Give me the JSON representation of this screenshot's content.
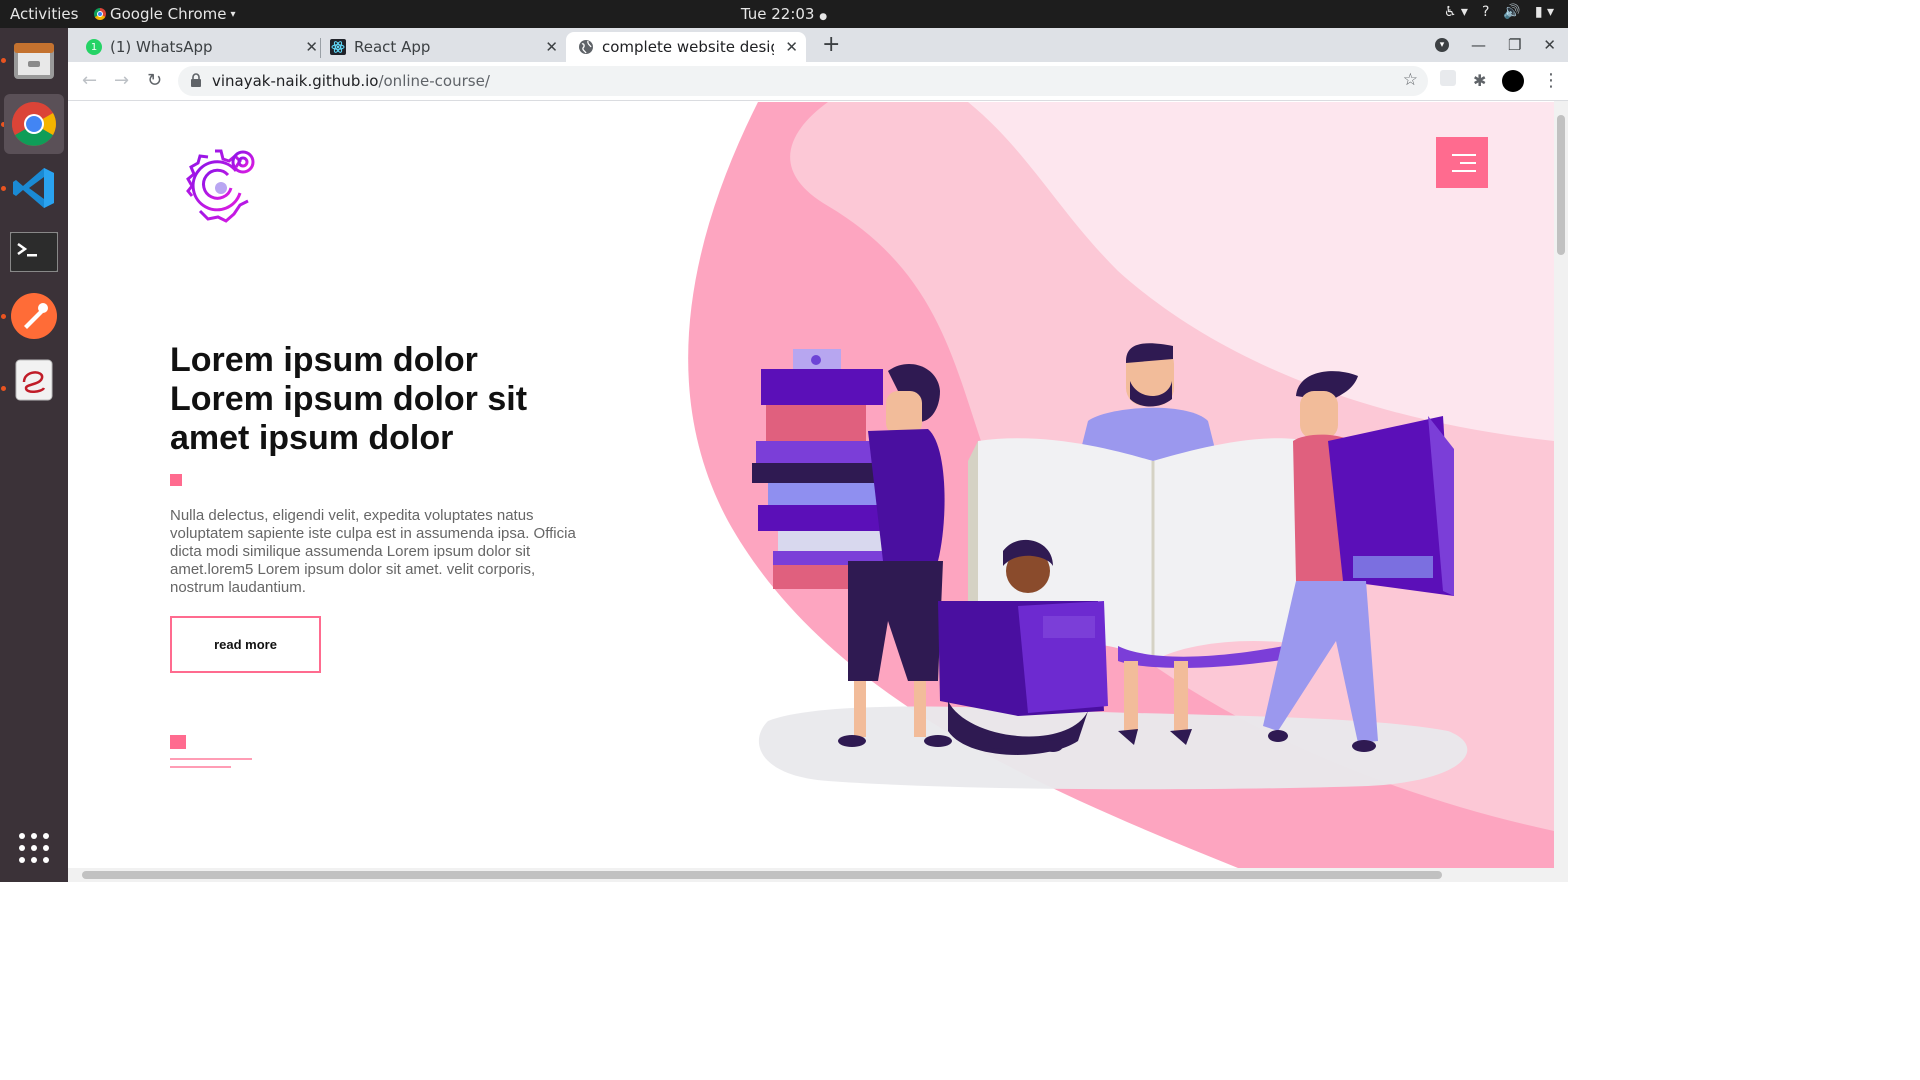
{
  "system": {
    "activities": "Activities",
    "app_name": "Google Chrome",
    "clock": "Tue 22:03"
  },
  "browser": {
    "tabs": [
      {
        "title": "(1) WhatsApp",
        "icon": "whatsapp-icon",
        "badge": "1"
      },
      {
        "title": "React App",
        "icon": "react-icon"
      },
      {
        "title": "complete website design",
        "icon": "globe-icon",
        "active": true
      }
    ],
    "url_host": "vinayak-naik.github.io",
    "url_path": "/online-course/"
  },
  "hero": {
    "title_lines": [
      "Lorem ipsum dolor",
      "Lorem ipsum dolor sit",
      "amet ipsum dolor"
    ],
    "paragraph": "Nulla delectus, eligendi velit, expedita voluptates natus voluptatem sapiente iste culpa est in assumenda ipsa. Officia dicta modi similique assumenda Lorem ipsum dolor sit amet.lorem5 Lorem ipsum dolor sit amet. velit corporis, nostrum laudantium.",
    "button_label": "read more"
  },
  "colors": {
    "accent": "#ff6b8f",
    "logo_purple": "#b016e8",
    "illustration_purple": "#5b0fb8"
  }
}
